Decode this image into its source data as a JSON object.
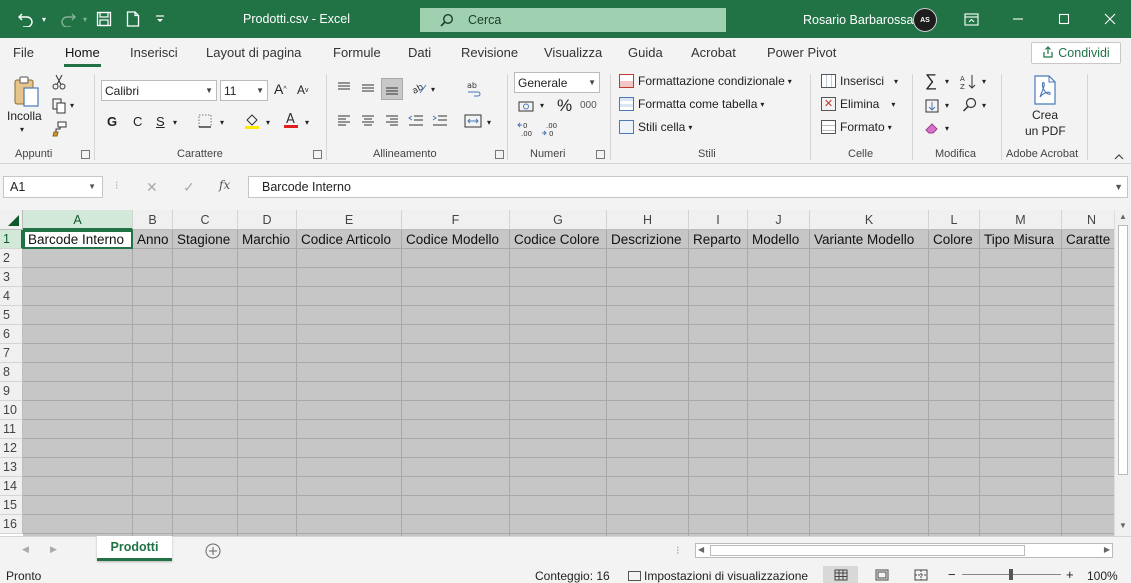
{
  "title_bar": {
    "file_title": "Prodotti.csv  -  Excel",
    "search_placeholder": "Cerca",
    "user_name": "Rosario Barbarossa",
    "avatar_text": "AS"
  },
  "menu": {
    "tabs": [
      "File",
      "Home",
      "Inserisci",
      "Layout di pagina",
      "Formule",
      "Dati",
      "Revisione",
      "Visualizza",
      "Guida",
      "Acrobat",
      "Power Pivot"
    ],
    "active_tab": "Home",
    "share_label": "Condividi"
  },
  "ribbon": {
    "clipboard": {
      "paste_label": "Incolla",
      "group_label": "Appunti"
    },
    "font": {
      "font_name": "Calibri",
      "font_size": "11",
      "bold": "G",
      "italic": "C",
      "underline": "S",
      "group_label": "Carattere"
    },
    "alignment": {
      "group_label": "Allineamento"
    },
    "number": {
      "format": "Generale",
      "percent": "%",
      "thousands": "000",
      "group_label": "Numeri"
    },
    "styles": {
      "conditional": "Formattazione condizionale",
      "as_table": "Formatta come tabella",
      "cell_styles": "Stili cella",
      "group_label": "Stili"
    },
    "cells": {
      "insert": "Inserisci",
      "delete": "Elimina",
      "format": "Formato",
      "group_label": "Celle"
    },
    "editing": {
      "group_label": "Modifica"
    },
    "acrobat": {
      "create_pdf_line1": "Crea",
      "create_pdf_line2": "un PDF",
      "group_label": "Adobe Acrobat"
    }
  },
  "formula_bar": {
    "name_box": "A1",
    "fx": "fx",
    "content": "Barcode Interno"
  },
  "grid": {
    "columns": [
      "A",
      "B",
      "C",
      "D",
      "E",
      "F",
      "G",
      "H",
      "I",
      "J",
      "K",
      "L",
      "M",
      "N"
    ],
    "rows": [
      "1",
      "2",
      "3",
      "4",
      "5",
      "6",
      "7",
      "8",
      "9",
      "10",
      "11",
      "12",
      "13",
      "14",
      "15",
      "16"
    ],
    "header_row": [
      "Barcode Interno",
      "Anno",
      "Stagione",
      "Marchio",
      "Codice Articolo",
      "Codice Modello",
      "Codice Colore",
      "Descrizione",
      "Reparto",
      "Modello",
      "Variante Modello",
      "Colore",
      "Tipo Misura",
      "Caratte"
    ]
  },
  "sheets": {
    "tabs": [
      "Prodotti"
    ],
    "active": "Prodotti"
  },
  "status_bar": {
    "ready": "Pronto",
    "count": "Conteggio: 16",
    "display_settings": "Impostazioni di visualizzazione",
    "minus": "−",
    "plus": "+",
    "zoom": "100%"
  }
}
